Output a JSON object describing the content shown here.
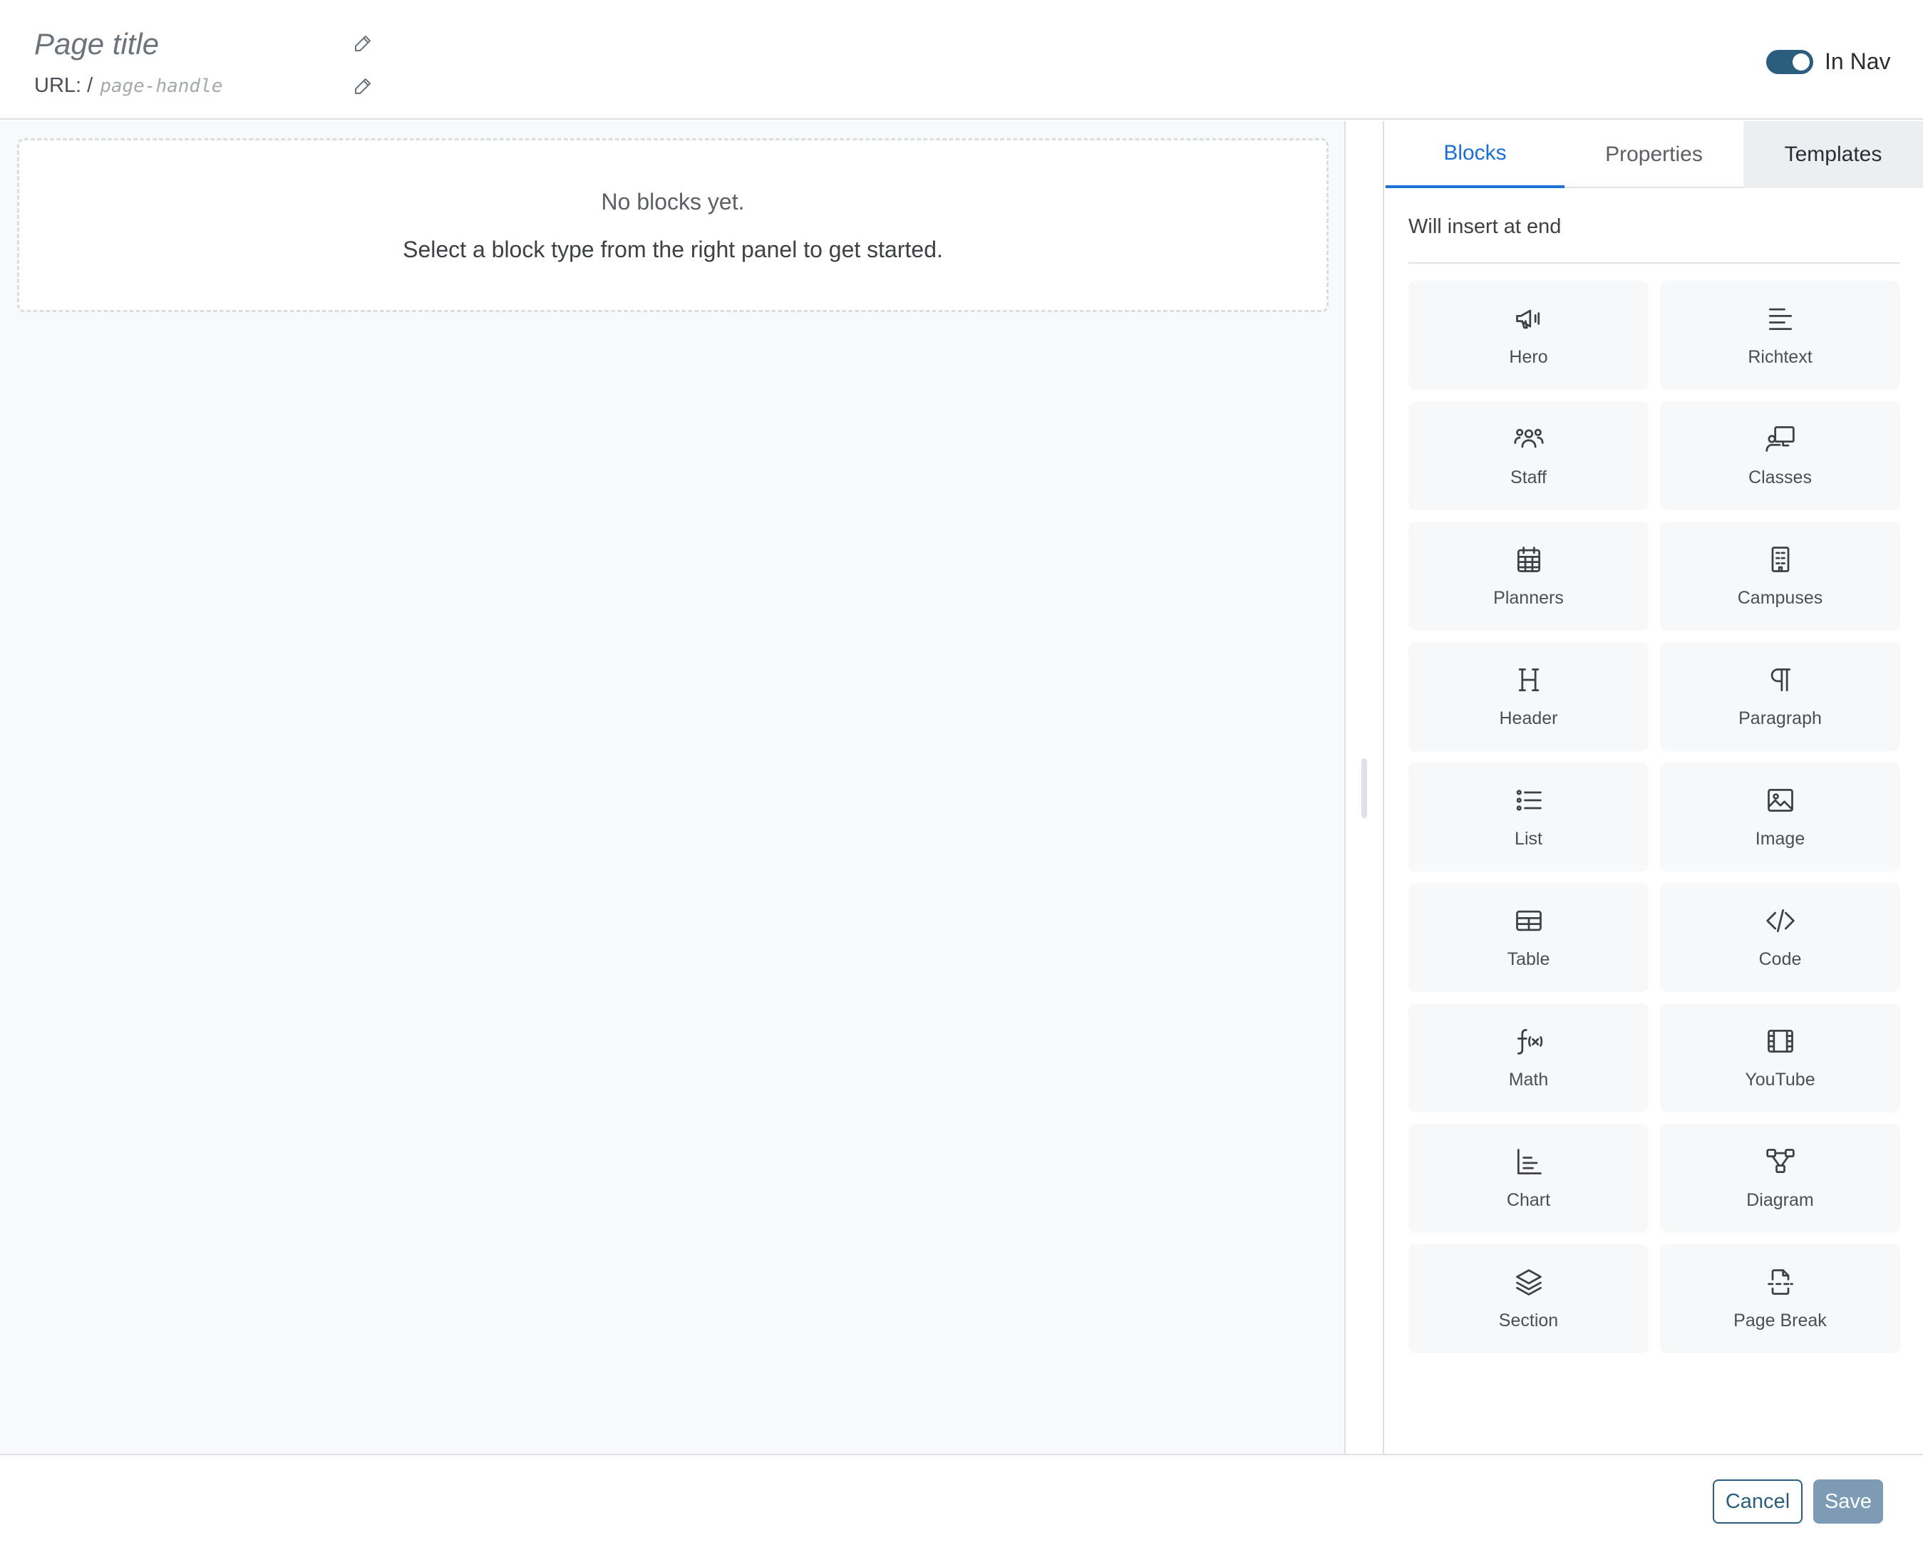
{
  "header": {
    "title_placeholder": "Page title",
    "url_label": "URL: /",
    "url_placeholder": "page-handle",
    "nav_toggle_label": "In Nav",
    "nav_toggle_on": true
  },
  "canvas": {
    "empty_title": "No blocks yet.",
    "empty_subtitle": "Select a block type from the right panel to get started."
  },
  "panel": {
    "tabs": [
      {
        "label": "Blocks",
        "active": true
      },
      {
        "label": "Properties",
        "active": false
      },
      {
        "label": "Templates",
        "active": false
      }
    ],
    "insert_note": "Will insert at end",
    "blocks": [
      {
        "label": "Hero",
        "icon": "megaphone-icon"
      },
      {
        "label": "Richtext",
        "icon": "text-lines-icon"
      },
      {
        "label": "Staff",
        "icon": "users-icon"
      },
      {
        "label": "Classes",
        "icon": "presentation-icon"
      },
      {
        "label": "Planners",
        "icon": "calendar-grid-icon"
      },
      {
        "label": "Campuses",
        "icon": "building-icon"
      },
      {
        "label": "Header",
        "icon": "heading-icon"
      },
      {
        "label": "Paragraph",
        "icon": "pilcrow-icon"
      },
      {
        "label": "List",
        "icon": "list-icon"
      },
      {
        "label": "Image",
        "icon": "image-icon"
      },
      {
        "label": "Table",
        "icon": "table-icon"
      },
      {
        "label": "Code",
        "icon": "code-icon"
      },
      {
        "label": "Math",
        "icon": "function-icon"
      },
      {
        "label": "YouTube",
        "icon": "film-icon"
      },
      {
        "label": "Chart",
        "icon": "chart-icon"
      },
      {
        "label": "Diagram",
        "icon": "diagram-icon"
      },
      {
        "label": "Section",
        "icon": "layers-icon"
      },
      {
        "label": "Page Break",
        "icon": "page-break-icon"
      }
    ]
  },
  "footer": {
    "cancel_label": "Cancel",
    "save_label": "Save"
  },
  "colors": {
    "accent": "#1b6fd8",
    "primary_dark": "#2b5d7e",
    "save_disabled": "#7d9bb5"
  }
}
